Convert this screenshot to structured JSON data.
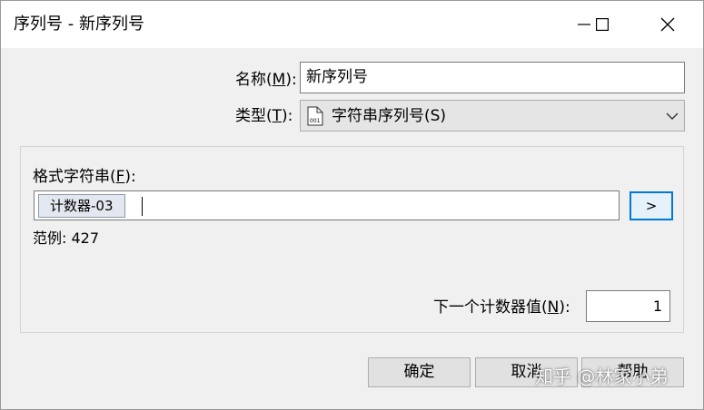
{
  "window": {
    "title": "序列号 - 新序列号",
    "controls": {
      "minimize_icon": "minimize-icon",
      "maximize_icon": "maximize-icon",
      "close_icon": "close-icon"
    }
  },
  "name_field": {
    "label_prefix": "名称(",
    "label_key": "M",
    "label_suffix": "):",
    "value": "新序列号"
  },
  "type_field": {
    "label_prefix": "类型(",
    "label_key": "T",
    "label_suffix": "):",
    "icon": "serial-file-icon",
    "icon_text": "001",
    "value": "字符串序列号(S)"
  },
  "format_group": {
    "label_prefix": "格式字符串(",
    "label_key": "F",
    "label_suffix": "):",
    "token": "计数器-03",
    "insert_button": ">",
    "example_label": "范例: 427"
  },
  "next_counter": {
    "label_prefix": "下一个计数器值(",
    "label_key": "N",
    "label_suffix": "):",
    "value": "1"
  },
  "buttons": {
    "ok": "确定",
    "cancel": "取消",
    "help": "帮助"
  },
  "watermark": "知乎 @林家小弟"
}
